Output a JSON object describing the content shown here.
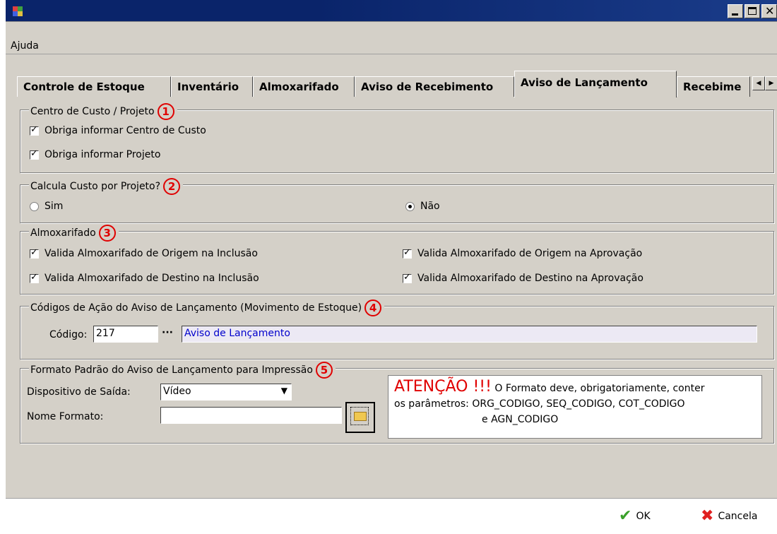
{
  "window": {
    "menu": [
      "Ajuda"
    ]
  },
  "tabs": [
    {
      "label": "Controle de Estoque"
    },
    {
      "label": "Inventário"
    },
    {
      "label": "Almoxarifado"
    },
    {
      "label": "Aviso de Recebimento"
    },
    {
      "label": "Aviso de Lançamento",
      "active": true
    },
    {
      "label": "Recebime"
    }
  ],
  "group1": {
    "title": "Centro de Custo / Projeto",
    "badge": "1",
    "checks": [
      "Obriga informar Centro de Custo",
      "Obriga informar Projeto"
    ]
  },
  "group2": {
    "title": "Calcula Custo por Projeto?",
    "badge": "2",
    "options": [
      "Sim",
      "Não"
    ],
    "selected": "Não"
  },
  "group3": {
    "title": "Almoxarifado",
    "badge": "3",
    "checks": [
      "Valida Almoxarifado de Origem na Inclusão",
      "Valida Almoxarifado de Origem na Aprovação",
      "Valida Almoxarifado de Destino na Inclusão",
      "Valida Almoxarifado de Destino na Aprovação"
    ]
  },
  "group4": {
    "title": "Códigos de Ação do Aviso de Lançamento (Movimento de Estoque)",
    "badge": "4",
    "codigo_label": "Código:",
    "codigo_value": "217",
    "ellipsis": "···",
    "descricao": "Aviso de Lançamento"
  },
  "group5": {
    "title": "Formato Padrão do Aviso de Lançamento para Impressão",
    "badge": "5",
    "dispositivo_label": "Dispositivo de Saída:",
    "dispositivo_value": "Vídeo",
    "nome_label": "Nome Formato:",
    "nome_value": "",
    "warning_big": "ATENÇÃO !!!",
    "warning_text1": " O Formato deve, obrigatoriamente, conter",
    "warning_text2": "os parâmetros: ORG_CODIGO, SEQ_CODIGO, COT_CODIGO",
    "warning_text3": "e AGN_CODIGO"
  },
  "footer": {
    "ok": "OK",
    "cancel": "Cancela"
  },
  "colors": {
    "title_bar": "#0a246a",
    "panel": "#d4d0c8",
    "badge": "#e00000",
    "link_text": "#0000cc"
  }
}
